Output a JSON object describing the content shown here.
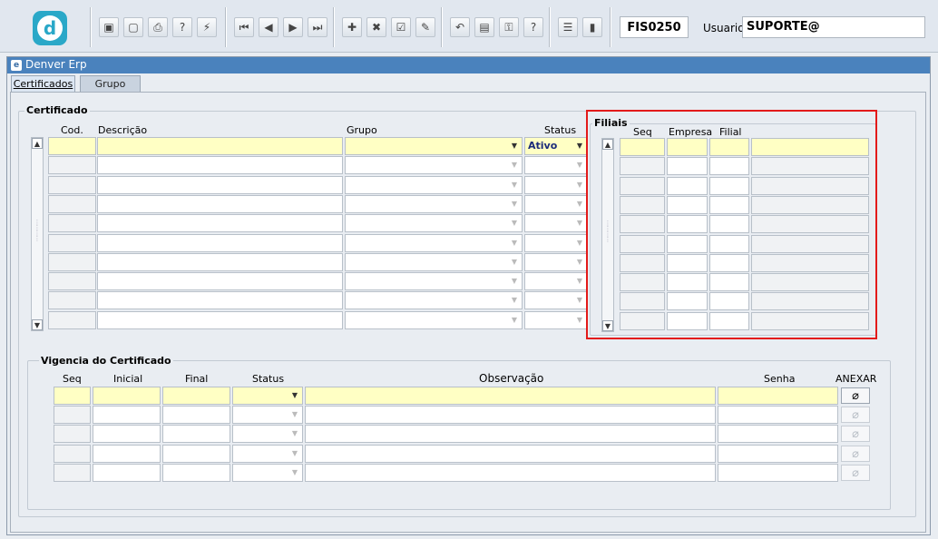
{
  "toolbar": {
    "form_code": "FIS0250",
    "user_label": "Usuario",
    "user_value": "SUPORTE@",
    "help_glyph": "?",
    "buttons": [
      {
        "name": "save-icon",
        "glyph": "▣"
      },
      {
        "name": "window-icon",
        "glyph": "▢"
      },
      {
        "name": "print-icon",
        "glyph": "⎙"
      },
      {
        "name": "query-icon",
        "glyph": "?"
      },
      {
        "name": "execute-query-icon",
        "glyph": "⚡"
      },
      {
        "name": "first-record-icon",
        "glyph": "⏮"
      },
      {
        "name": "previous-record-icon",
        "glyph": "◀"
      },
      {
        "name": "next-record-icon",
        "glyph": "▶"
      },
      {
        "name": "last-record-icon",
        "glyph": "⏭"
      },
      {
        "name": "insert-record-icon",
        "glyph": "✚"
      },
      {
        "name": "delete-record-icon",
        "glyph": "✖"
      },
      {
        "name": "list-values-icon",
        "glyph": "☑"
      },
      {
        "name": "edit-icon",
        "glyph": "✎"
      },
      {
        "name": "undo-icon",
        "glyph": "↶"
      },
      {
        "name": "clipboard-icon",
        "glyph": "▤"
      },
      {
        "name": "key-icon",
        "glyph": "⚿"
      },
      {
        "name": "help-icon",
        "glyph": "?"
      },
      {
        "name": "menu-icon",
        "glyph": "☰"
      },
      {
        "name": "exit-icon",
        "glyph": "▮"
      }
    ]
  },
  "window": {
    "title": "Denver Erp"
  },
  "tabs": [
    {
      "label": "Certificados"
    },
    {
      "label": "Grupo"
    }
  ],
  "certificado": {
    "title": "Certificado",
    "headers": {
      "cod": "Cod.",
      "descricao": "Descrição",
      "grupo": "Grupo",
      "status": "Status"
    },
    "first_row_status": "Ativo",
    "row_count": 10
  },
  "filiais": {
    "title": "Filiais",
    "headers": {
      "seq": "Seq",
      "empresa": "Empresa",
      "filial": "Filial"
    },
    "row_count": 10
  },
  "vigencia": {
    "title": "Vigencia do Certificado",
    "headers": {
      "seq": "Seq",
      "inicial": "Inicial",
      "final": "Final",
      "status": "Status",
      "observacao": "Observação",
      "senha": "Senha",
      "anexar": "ANEXAR"
    },
    "row_count": 5
  },
  "colors": {
    "titlebar": "#4a82bd",
    "current_row": "#ffffc4",
    "highlight_border": "#e31a1a",
    "logo": "#2aa8c8"
  }
}
